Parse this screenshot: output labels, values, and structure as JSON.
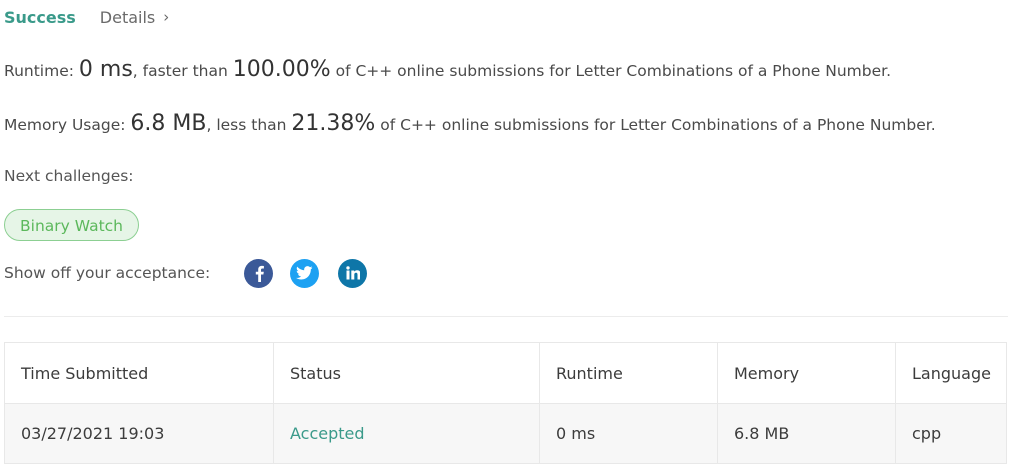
{
  "header": {
    "success": "Success",
    "details": "Details",
    "chevron": "›"
  },
  "runtime": {
    "label": "Runtime:",
    "value": "0 ms",
    "comparison": ", faster than",
    "percent": "100.00%",
    "suffix": "of C++ online submissions for Letter Combinations of a Phone Number."
  },
  "memory": {
    "label": "Memory Usage:",
    "value": "6.8 MB",
    "comparison": ", less than",
    "percent": "21.38%",
    "suffix": "of C++ online submissions for Letter Combinations of a Phone Number."
  },
  "next_challenges": {
    "label": "Next challenges:",
    "items": [
      "Binary Watch"
    ]
  },
  "share": {
    "label": "Show off your acceptance:",
    "icons": [
      "facebook-icon",
      "twitter-icon",
      "linkedin-icon"
    ]
  },
  "colors": {
    "success": "#3a9a8a",
    "accepted": "#3a9a8a",
    "tag_bg": "#e6f5e7",
    "tag_border": "#8ccf92",
    "tag_text": "#5cb85c",
    "facebook": "#3b5998",
    "twitter": "#1da1f2",
    "linkedin": "#0e76a8"
  },
  "table": {
    "headers": [
      "Time Submitted",
      "Status",
      "Runtime",
      "Memory",
      "Language"
    ],
    "rows": [
      [
        "03/27/2021 19:03",
        "Accepted",
        "0 ms",
        "6.8 MB",
        "cpp"
      ]
    ]
  }
}
